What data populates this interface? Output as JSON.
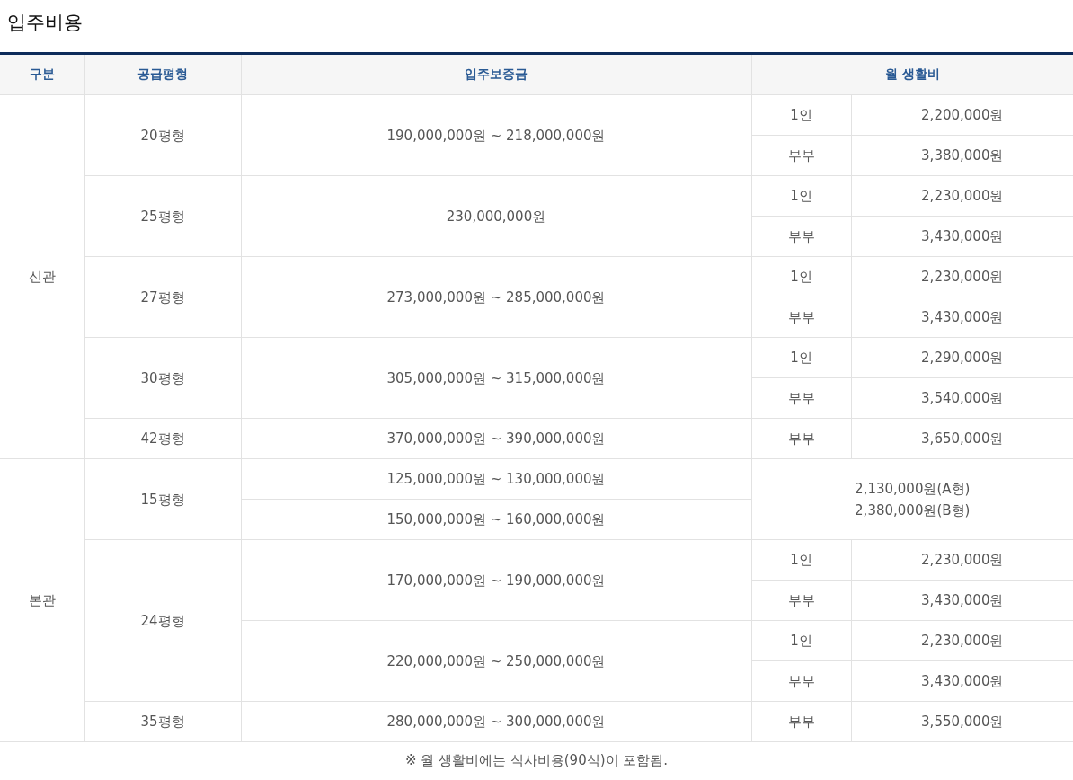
{
  "title": "입주비용",
  "columns": [
    "구분",
    "공급평형",
    "입주보증금",
    "월 생활비"
  ],
  "sections": [
    {
      "name": "신관",
      "types": [
        {
          "size": "20평형",
          "deposits": [
            {
              "range": "190,000,000원 ~ 218,000,000원",
              "costs": [
                {
                  "who": "1인",
                  "amount": "2,200,000원"
                },
                {
                  "who": "부부",
                  "amount": "3,380,000원"
                }
              ]
            }
          ]
        },
        {
          "size": "25평형",
          "deposits": [
            {
              "range": "230,000,000원",
              "costs": [
                {
                  "who": "1인",
                  "amount": "2,230,000원"
                },
                {
                  "who": "부부",
                  "amount": "3,430,000원"
                }
              ]
            }
          ]
        },
        {
          "size": "27평형",
          "deposits": [
            {
              "range": "273,000,000원 ~ 285,000,000원",
              "costs": [
                {
                  "who": "1인",
                  "amount": "2,230,000원"
                },
                {
                  "who": "부부",
                  "amount": "3,430,000원"
                }
              ]
            }
          ]
        },
        {
          "size": "30평형",
          "deposits": [
            {
              "range": "305,000,000원 ~ 315,000,000원",
              "costs": [
                {
                  "who": "1인",
                  "amount": "2,290,000원"
                },
                {
                  "who": "부부",
                  "amount": "3,540,000원"
                }
              ]
            }
          ]
        },
        {
          "size": "42평형",
          "deposits": [
            {
              "range": "370,000,000원 ~ 390,000,000원",
              "costs": [
                {
                  "who": "부부",
                  "amount": "3,650,000원"
                }
              ]
            }
          ]
        }
      ]
    },
    {
      "name": "본관",
      "types": [
        {
          "size": "15평형",
          "deposits": [
            {
              "range": "125,000,000원 ~ 130,000,000원"
            },
            {
              "range": "150,000,000원 ~ 160,000,000원"
            }
          ],
          "combined_costs": [
            "2,130,000원(A형)",
            "2,380,000원(B형)"
          ]
        },
        {
          "size": "24평형",
          "deposits": [
            {
              "range": "170,000,000원 ~ 190,000,000원",
              "costs": [
                {
                  "who": "1인",
                  "amount": "2,230,000원"
                },
                {
                  "who": "부부",
                  "amount": "3,430,000원"
                }
              ]
            },
            {
              "range": "220,000,000원 ~ 250,000,000원",
              "costs": [
                {
                  "who": "1인",
                  "amount": "2,230,000원"
                },
                {
                  "who": "부부",
                  "amount": "3,430,000원"
                }
              ]
            }
          ]
        },
        {
          "size": "35평형",
          "deposits": [
            {
              "range": "280,000,000원 ~ 300,000,000원",
              "costs": [
                {
                  "who": "부부",
                  "amount": "3,550,000원"
                }
              ]
            }
          ]
        }
      ]
    }
  ],
  "footnote": "※ 월 생활비에는 식사비용(90식)이 포함됨."
}
